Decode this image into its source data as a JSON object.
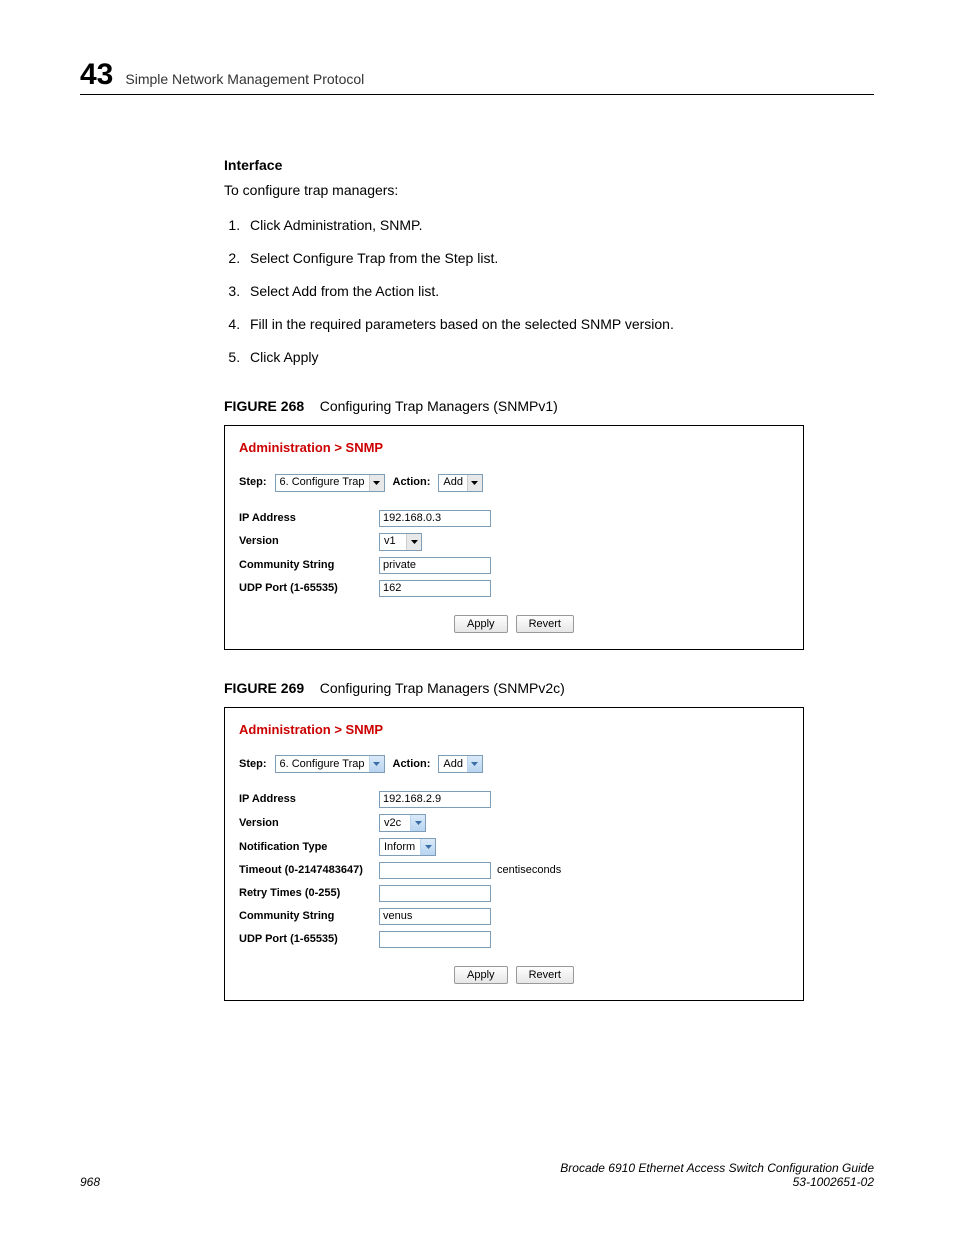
{
  "header": {
    "chapter_number": "43",
    "chapter_title": "Simple Network Management Protocol"
  },
  "section": {
    "heading": "Interface",
    "intro": "To configure trap managers:",
    "steps": [
      "Click Administration, SNMP.",
      "Select Configure Trap from the Step list.",
      "Select Add from the Action list.",
      "Fill in the required parameters based on the selected SNMP version.",
      "Click Apply"
    ]
  },
  "figure268": {
    "label_prefix": "FIGURE 268",
    "label_text": "Configuring Trap Managers (SNMPv1)",
    "breadcrumb": "Administration > SNMP",
    "step_label": "Step:",
    "step_value": "6. Configure Trap",
    "action_label": "Action:",
    "action_value": "Add",
    "fields": {
      "ip_label": "IP Address",
      "ip_value": "192.168.0.3",
      "version_label": "Version",
      "version_value": "v1",
      "community_label": "Community String",
      "community_value": "private",
      "udp_label": "UDP Port (1-65535)",
      "udp_value": "162"
    },
    "apply": "Apply",
    "revert": "Revert"
  },
  "figure269": {
    "label_prefix": "FIGURE 269",
    "label_text": "Configuring Trap Managers (SNMPv2c)",
    "breadcrumb": "Administration > SNMP",
    "step_label": "Step:",
    "step_value": "6. Configure Trap",
    "action_label": "Action:",
    "action_value": "Add",
    "fields": {
      "ip_label": "IP Address",
      "ip_value": "192.168.2.9",
      "version_label": "Version",
      "version_value": "v2c",
      "notif_label": "Notification Type",
      "notif_value": "Inform",
      "timeout_label": "Timeout (0-2147483647)",
      "timeout_value": "",
      "timeout_suffix": "centiseconds",
      "retry_label": "Retry Times (0-255)",
      "retry_value": "",
      "community_label": "Community String",
      "community_value": "venus",
      "udp_label": "UDP Port (1-65535)",
      "udp_value": ""
    },
    "apply": "Apply",
    "revert": "Revert"
  },
  "footer": {
    "page_number": "968",
    "title": "Brocade 6910 Ethernet Access Switch Configuration Guide",
    "doc_id": "53-1002651-02"
  }
}
